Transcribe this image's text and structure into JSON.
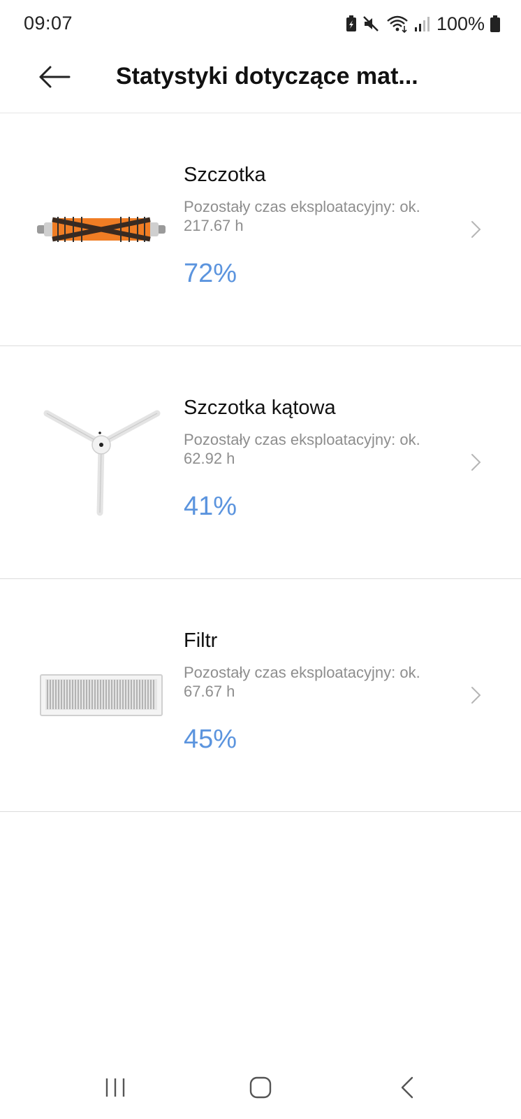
{
  "status_bar": {
    "time": "09:07",
    "battery": "100%",
    "icons": [
      "battery-saver-icon",
      "mute-icon",
      "wifi-icon",
      "signal-icon",
      "battery-icon"
    ]
  },
  "header": {
    "title": "Statystyki dotyczące mat...",
    "back_icon": "arrow-left-icon"
  },
  "items": [
    {
      "name": "Szczotka",
      "desc_line1": "Pozostały czas eksploatacyjny: ok.",
      "desc_line2": "217.67 h",
      "percent": "72%",
      "image": "main-brush-image"
    },
    {
      "name": "Szczotka kątowa",
      "desc_line1": "Pozostały czas eksploatacyjny: ok.",
      "desc_line2": "62.92 h",
      "percent": "41%",
      "image": "side-brush-image"
    },
    {
      "name": "Filtr",
      "desc_line1": "Pozostały czas eksploatacyjny: ok.",
      "desc_line2": "67.67 h",
      "percent": "45%",
      "image": "filter-image"
    }
  ],
  "nav": {
    "icons": [
      "recents-icon",
      "home-icon",
      "back-icon"
    ]
  },
  "colors": {
    "accent": "#5b94de",
    "brush_orange": "#f07d24",
    "secondary_text": "#8e8e8e"
  }
}
